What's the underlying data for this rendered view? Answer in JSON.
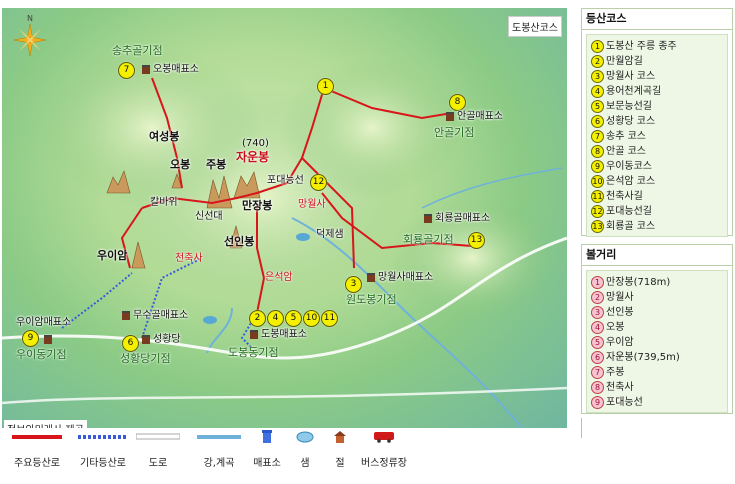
{
  "map": {
    "corner_label": "도봉산코스",
    "credit": "정보와미래사 제공",
    "compass_letter": "N",
    "gates": [
      {
        "name": "송추골기점",
        "num": "7",
        "shop": "오봉매표소"
      },
      {
        "name": "안골기점",
        "num": "8",
        "shop": "안골매표소"
      },
      {
        "name": "회룡골기점",
        "num": "13",
        "shop": "회룡골매표소"
      },
      {
        "name": "원도봉기점",
        "num": "3",
        "shop": "망월사매표소"
      },
      {
        "name": "도봉동기점",
        "nums": [
          "2",
          "4",
          "5",
          "10",
          "11"
        ],
        "shop": "도봉매표소"
      },
      {
        "name": "성황당기점",
        "num": "6",
        "shop": "성황당"
      },
      {
        "name": "우이동기점",
        "num": "9",
        "shop": "우이암매표소"
      },
      {
        "shop": "무수골매표소"
      }
    ],
    "peaks": {
      "yeoseong": "여성봉",
      "obong": "오봉",
      "jubong": "주봉",
      "jaun_alt": "(740)",
      "jaun": "자운봉",
      "podae": "포대능선",
      "kalbawi": "칼바위",
      "sinseondae": "신선대",
      "manjang": "만장봉",
      "seonin": "선인봉",
      "uiam": "우이암",
      "mangwolsa": "망월사",
      "cheonchuksa": "천축사",
      "eunseokam": "은석암",
      "deokje": "덕제샘"
    },
    "top_num": "1",
    "podae_num": "12"
  },
  "legend": [
    {
      "label": "주요등산로",
      "icon": "red-line",
      "color": "#d8151b"
    },
    {
      "label": "기타등산로",
      "icon": "blue-dotted-line",
      "color": "#3a5bd9"
    },
    {
      "label": "도로",
      "icon": "white-road",
      "color": "#ffffff"
    },
    {
      "label": "강,계곡",
      "icon": "stream-line",
      "color": "#6fb2d9"
    },
    {
      "label": "매표소",
      "icon": "ticket-booth-icon"
    },
    {
      "label": "샘",
      "icon": "spring-icon"
    },
    {
      "label": "절",
      "icon": "temple-icon"
    },
    {
      "label": "버스정류장",
      "icon": "bus-icon"
    }
  ],
  "courses_panel": {
    "title": "등산코스",
    "items": [
      {
        "n": "1",
        "t": "도봉산 주릉 종주"
      },
      {
        "n": "2",
        "t": "만월암길"
      },
      {
        "n": "3",
        "t": "망월사 코스"
      },
      {
        "n": "4",
        "t": "용어천계곡길"
      },
      {
        "n": "5",
        "t": "보문능선길"
      },
      {
        "n": "6",
        "t": "성황당 코스"
      },
      {
        "n": "7",
        "t": "송추 코스"
      },
      {
        "n": "8",
        "t": "안골 코스"
      },
      {
        "n": "9",
        "t": "우이동코스"
      },
      {
        "n": "10",
        "t": "은석암 코스"
      },
      {
        "n": "11",
        "t": "천축사길"
      },
      {
        "n": "12",
        "t": "포대능선길"
      },
      {
        "n": "13",
        "t": "회룡골 코스"
      }
    ]
  },
  "peaks_panel": {
    "title": "볼거리",
    "items": [
      {
        "n": "1",
        "t": "만장봉(718m)"
      },
      {
        "n": "2",
        "t": "망월사"
      },
      {
        "n": "3",
        "t": "선인봉"
      },
      {
        "n": "4",
        "t": "오봉"
      },
      {
        "n": "5",
        "t": "우이암"
      },
      {
        "n": "6",
        "t": "자운봉(739,5m)"
      },
      {
        "n": "7",
        "t": "주봉"
      },
      {
        "n": "8",
        "t": "천축사"
      },
      {
        "n": "9",
        "t": "포대능선"
      }
    ]
  }
}
